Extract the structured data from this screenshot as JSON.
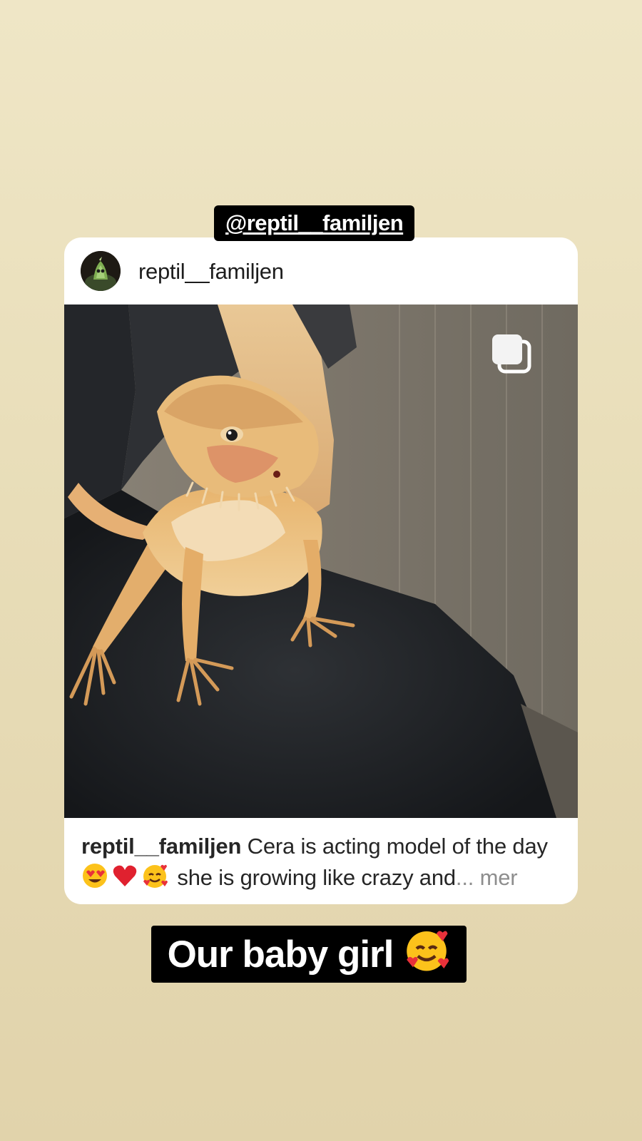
{
  "story": {
    "mention_sticker": "@reptil__familjen",
    "text_sticker": "Our baby girl",
    "text_sticker_emoji": "smiling-face-with-hearts"
  },
  "post": {
    "username": "reptil__familjen",
    "avatar_icon": "chameleon-avatar",
    "carousel_indicator_icon": "carousel-multiple-icon",
    "caption": {
      "username": "reptil__familjen",
      "line1": "Cera is acting model of the day",
      "emojis": [
        "heart-eyes",
        "red-heart",
        "smiling-face-with-hearts"
      ],
      "line2": "she is growing like crazy and",
      "ellipsis": "...",
      "more": "mer"
    }
  },
  "colors": {
    "background_top": "#efe6c6",
    "background_bottom": "#e1d3ab",
    "sticker_bg": "#000000",
    "more_link": "#8e8e8e"
  }
}
